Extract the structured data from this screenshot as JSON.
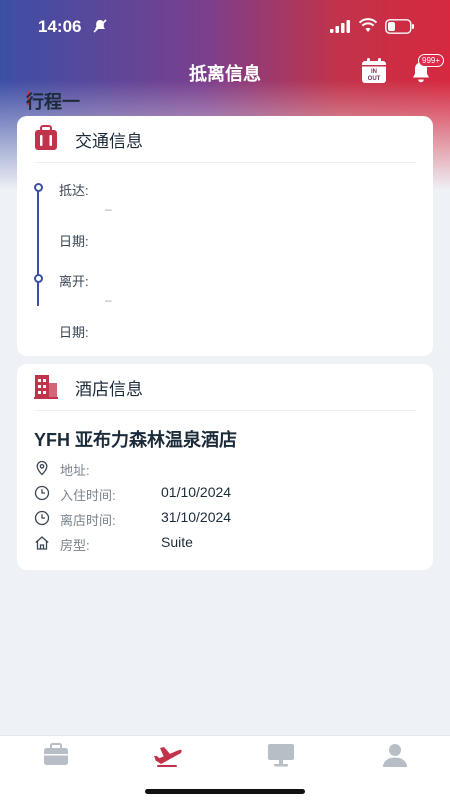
{
  "status_bar": {
    "time": "14:06",
    "icons": [
      "mute-icon",
      "signal-icon",
      "wifi-icon",
      "battery-icon"
    ]
  },
  "nav": {
    "title": "抵离信息",
    "inout_icon_text_top": "IN",
    "inout_icon_text_bottom": "OUT",
    "notification_badge": "999+"
  },
  "trip": {
    "title": "行程一"
  },
  "transport": {
    "title": "交通信息",
    "icon": "luggage-icon",
    "arrive_label": "抵达:",
    "arrive_value": "–",
    "arrive_date_label": "日期:",
    "depart_label": "离开:",
    "depart_value": "–",
    "depart_date_label": "日期:"
  },
  "hotel": {
    "title": "酒店信息",
    "icon": "building-icon",
    "name": "YFH 亚布力森林温泉酒店",
    "rows": [
      {
        "icon": "location-icon",
        "label": "地址:",
        "value": ""
      },
      {
        "icon": "clock-icon",
        "label": "入住时间:",
        "value": "01/10/2024"
      },
      {
        "icon": "clock-icon",
        "label": "离店时间:",
        "value": "31/10/2024"
      },
      {
        "icon": "home-icon",
        "label": "房型:",
        "value": "Suite"
      }
    ]
  },
  "tab_bar": {
    "tabs": [
      {
        "icon": "briefcase-icon",
        "active": false
      },
      {
        "icon": "airplane-icon",
        "active": true
      },
      {
        "icon": "monitor-icon",
        "active": false
      },
      {
        "icon": "person-icon",
        "active": false
      }
    ]
  },
  "colors": {
    "brand_blue": "#3c4fa6",
    "brand_red": "#d6283f",
    "tab_inactive": "#b8bec5"
  }
}
